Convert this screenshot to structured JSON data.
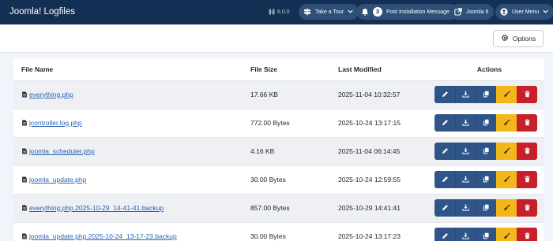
{
  "header": {
    "title": "Joomla! Logfiles",
    "version": "6.0.0",
    "buttons": {
      "tour": "Take a Tour",
      "messages_count": "3",
      "messages": "Post Installation Messages",
      "site": "Joomla 6",
      "user_menu": "User Menu"
    }
  },
  "toolbar": {
    "options_label": "Options"
  },
  "table": {
    "headers": {
      "name": "File Name",
      "size": "File Size",
      "modified": "Last Modified",
      "actions": "Actions"
    },
    "rows": [
      {
        "name": "everything.php",
        "size": "17.66 KB",
        "modified": "2025-11-04 10:32:57"
      },
      {
        "name": "jcontroller.log.php",
        "size": "772.00 Bytes",
        "modified": "2025-10-24 13:17:15"
      },
      {
        "name": "joomla_scheduler.php",
        "size": "4.16 KB",
        "modified": "2025-11-04 06:14:45"
      },
      {
        "name": "joomla_update.php",
        "size": "30.00 Bytes",
        "modified": "2025-10-24 12:59:55"
      },
      {
        "name": "everything.php.2025-10-29_14-41-41.backup",
        "size": "857.00 Bytes",
        "modified": "2025-10-29 14:41:41"
      },
      {
        "name": "joomla_update.php.2025-10-24_13-17-23.backup",
        "size": "30.00 Bytes",
        "modified": "2025-10-24 13:17:23"
      }
    ]
  },
  "colors": {
    "header_bg": "#132f53",
    "action_blue": "#2f5488",
    "action_yellow": "#f4b71a",
    "action_red": "#c8202b",
    "link": "#2a62b5"
  },
  "icons": {
    "actions": [
      "edit-icon",
      "download-icon",
      "copy-icon",
      "broom-icon",
      "trash-icon"
    ],
    "file": "file-icon"
  }
}
